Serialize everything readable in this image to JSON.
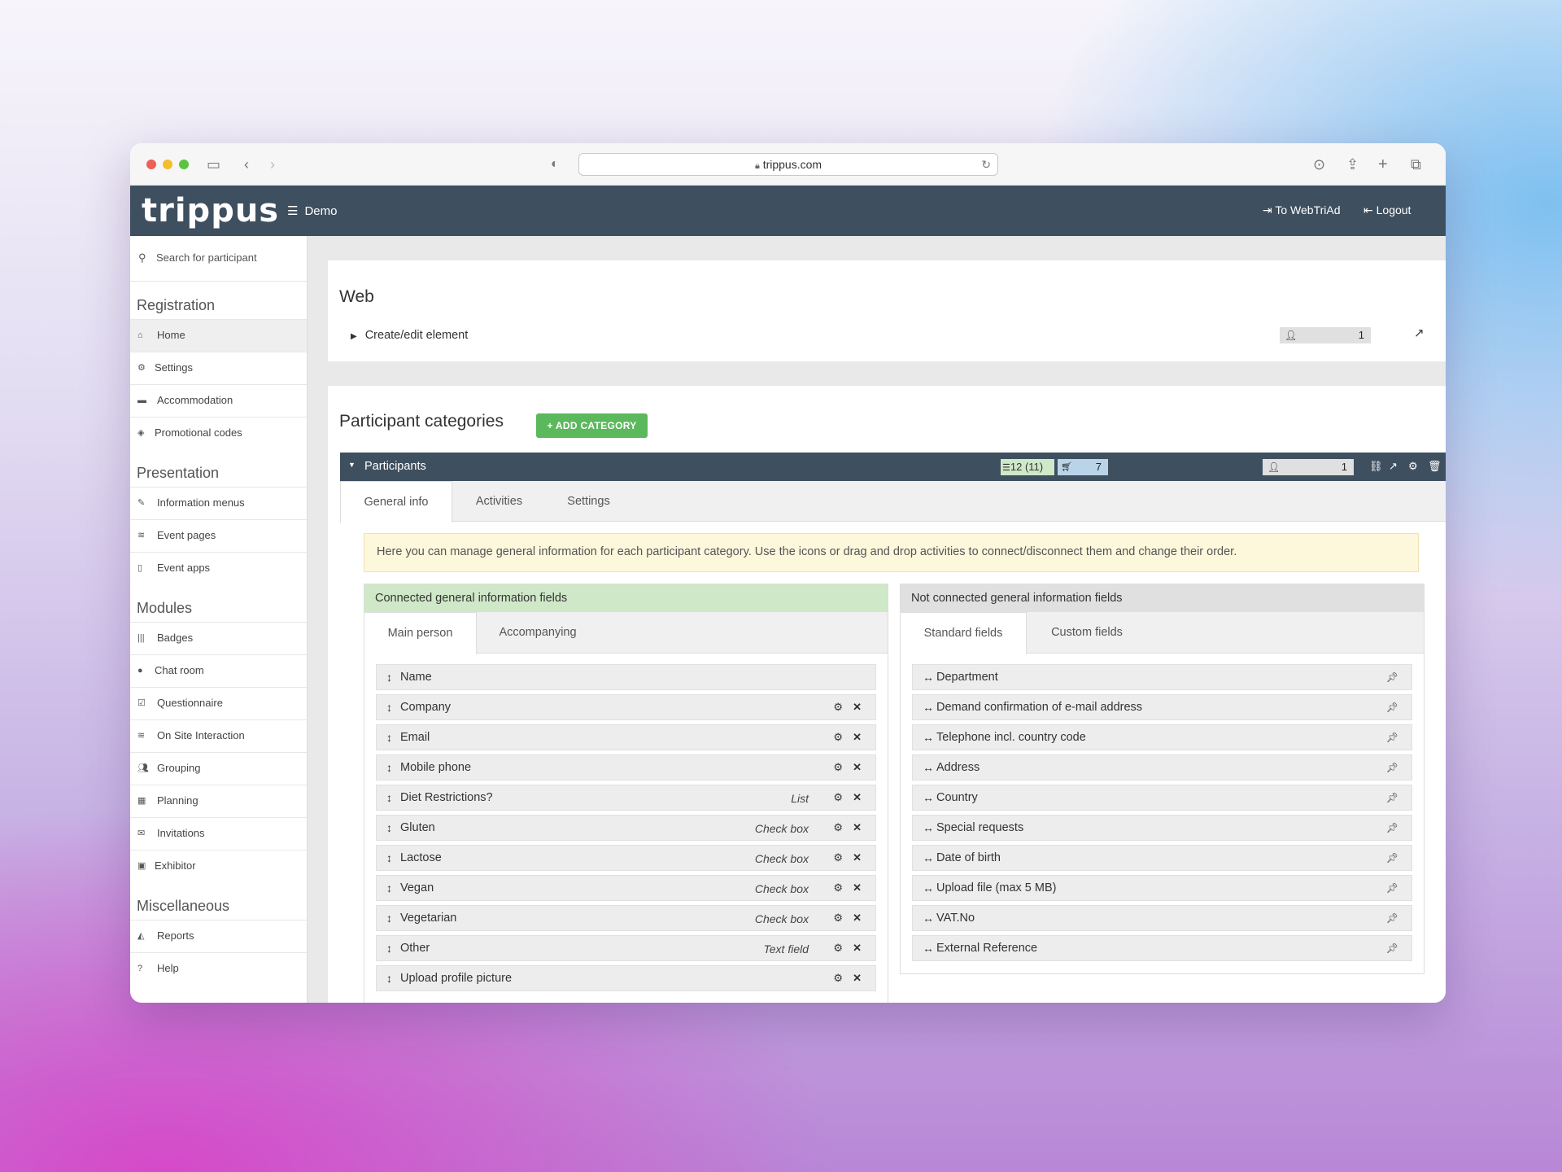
{
  "browser": {
    "url": "trippus.com"
  },
  "app": {
    "logo": "trippus",
    "menu_label": "Demo",
    "to_webtriad": "To WebTriAd",
    "logout": "Logout"
  },
  "sidebar": {
    "search_placeholder": "Search for participant",
    "sections": [
      {
        "title": "Registration",
        "items": [
          "Home",
          "Settings",
          "Accommodation",
          "Promotional codes"
        ]
      },
      {
        "title": "Presentation",
        "items": [
          "Information menus",
          "Event pages",
          "Event apps"
        ]
      },
      {
        "title": "Modules",
        "items": [
          "Badges",
          "Chat room",
          "Questionnaire",
          "On Site Interaction",
          "Grouping",
          "Planning",
          "Invitations",
          "Exhibitor"
        ]
      },
      {
        "title": "Miscellaneous",
        "items": [
          "Reports",
          "Help"
        ]
      }
    ]
  },
  "web_card": {
    "title": "Web",
    "create_edit": "Create/edit element",
    "count": "1"
  },
  "categories": {
    "title": "Participant categories",
    "add_button": "+ ADD CATEGORY",
    "category_name": "Participants",
    "registrations": "12 (11)",
    "cart_count": "7",
    "participant_count": "1",
    "tabs": [
      "General info",
      "Activities",
      "Settings"
    ],
    "info_text": "Here you can manage general information for each participant category. Use the icons or drag and drop activities to connect/disconnect them and change their order."
  },
  "connected": {
    "title": "Connected general information fields",
    "tabs": [
      "Main person",
      "Accompanying"
    ],
    "fields": [
      {
        "name": "Name",
        "type": ""
      },
      {
        "name": "Company",
        "type": ""
      },
      {
        "name": "Email",
        "type": ""
      },
      {
        "name": "Mobile phone",
        "type": ""
      },
      {
        "name": "Diet Restrictions?",
        "type": "List"
      },
      {
        "name": "Gluten",
        "type": "Check box"
      },
      {
        "name": "Lactose",
        "type": "Check box"
      },
      {
        "name": "Vegan",
        "type": "Check box"
      },
      {
        "name": "Vegetarian",
        "type": "Check box"
      },
      {
        "name": "Other",
        "type": "Text field"
      },
      {
        "name": "Upload profile picture",
        "type": ""
      }
    ]
  },
  "not_connected": {
    "title": "Not connected general information fields",
    "tabs": [
      "Standard fields",
      "Custom fields"
    ],
    "fields": [
      "Department",
      "Demand confirmation of e-mail address",
      "Telephone incl. country code",
      "Address",
      "Country",
      "Special requests",
      "Date of birth",
      "Upload file (max 5 MB)",
      "VAT.No",
      "External Reference"
    ]
  },
  "colors": {
    "header_bg": "#3e4f5f",
    "add_button": "#5cb85c",
    "connected_header": "#cfe8c8",
    "not_connected_header": "#e0e0e0",
    "alert_bg": "#fdf7dc",
    "registrations_badge": "#cfe8c8",
    "cart_badge": "#b9d4e8"
  }
}
